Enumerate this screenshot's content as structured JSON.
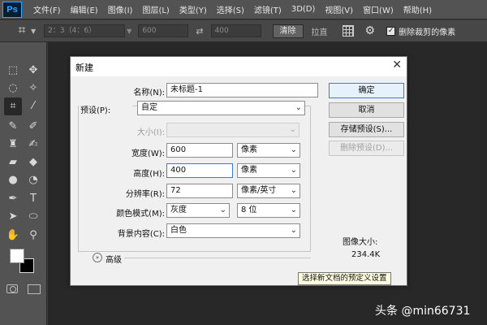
{
  "app": {
    "logo": "Ps"
  },
  "menubar": [
    "文件(F)",
    "编辑(E)",
    "图像(I)",
    "图层(L)",
    "类型(Y)",
    "选择(S)",
    "滤镜(T)",
    "3D(D)",
    "视图(V)",
    "窗口(W)",
    "帮助(H)"
  ],
  "options": {
    "ratio": "2：3（4：6）",
    "width": "600",
    "height": "400",
    "clear_label": "清除",
    "straighten_label": "拉直",
    "delete_cropped_label": "删除裁剪的像素",
    "delete_cropped_checked": true
  },
  "dialog": {
    "title": "新建",
    "name_label": "名称(N):",
    "name_value": "未标题-1",
    "preset_label": "预设(P):",
    "preset_value": "自定",
    "size_label": "大小(I):",
    "size_value": "",
    "width_label": "宽度(W):",
    "width_value": "600",
    "width_unit": "像素",
    "height_label": "高度(H):",
    "height_value": "400",
    "height_unit": "像素",
    "resolution_label": "分辨率(R):",
    "resolution_value": "72",
    "resolution_unit": "像素/英寸",
    "color_mode_label": "颜色模式(M):",
    "color_mode_value": "灰度",
    "bit_depth_value": "8 位",
    "background_label": "背景内容(C):",
    "background_value": "白色",
    "advanced_label": "高级",
    "buttons": {
      "ok": "确定",
      "cancel": "取消",
      "save_preset": "存储预设(S)...",
      "delete_preset": "删除预设(D)..."
    },
    "image_size_label": "图像大小:",
    "image_size_value": "234.4K"
  },
  "tooltip": "选择新文档的预定义设置",
  "watermark": "头条 @min66731",
  "colors": {
    "accent": "#3b7bd4",
    "ps_blue": "#31a8ff",
    "chrome": "#535353",
    "canvas": "#282828"
  }
}
